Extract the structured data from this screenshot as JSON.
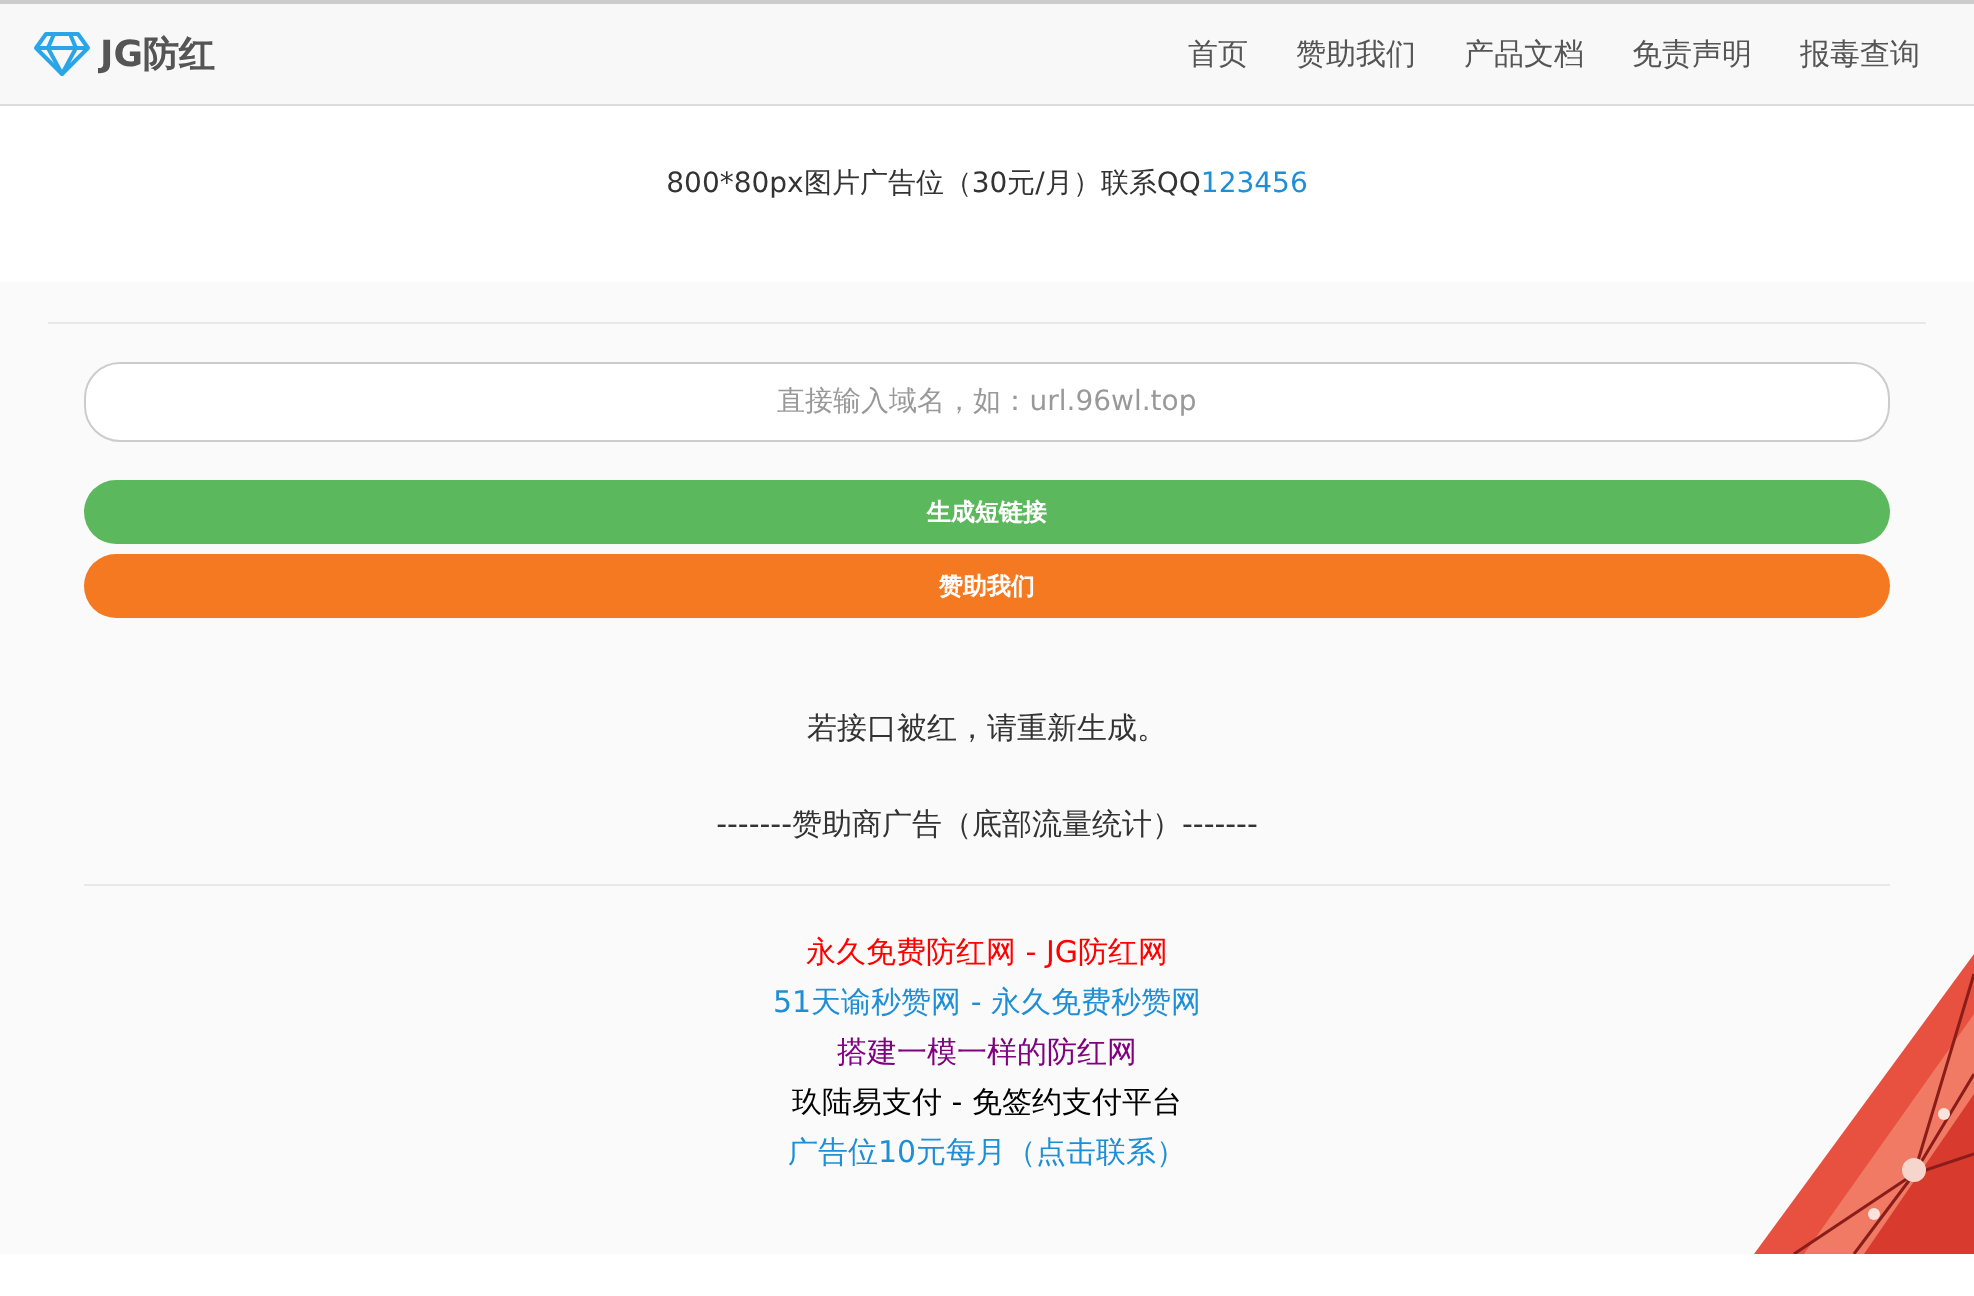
{
  "navbar": {
    "brand": "JG防红",
    "items": [
      "首页",
      "赞助我们",
      "产品文档",
      "免责声明",
      "报毒查询"
    ]
  },
  "ad_banner": {
    "text": "800*80px图片广告位（30元/月）联系QQ",
    "contact": "123456"
  },
  "form": {
    "placeholder": "直接输入域名，如：url.96wl.top",
    "buttons": [
      {
        "label": "生成短链接",
        "kind": "primary"
      },
      {
        "label": "赞助我们",
        "kind": "sponsor"
      }
    ]
  },
  "notice": "若接口被红，请重新生成。",
  "sponsor_heading": "-------赞助商广告（底部流量统计）-------",
  "sponsor_links": [
    {
      "text": "永久免费防红网 - JG防红网",
      "color": "#ff0000"
    },
    {
      "text": "51天谕秒赞网 - 永久免费秒赞网",
      "color": "#1e8fd6"
    },
    {
      "text": "搭建一模一样的防红网",
      "color": "#800080"
    },
    {
      "text": "玖陆易支付 - 免签约支付平台",
      "color": "#000000"
    },
    {
      "text": "广告位10元每月（点击联系）",
      "color": "#1e8fd6"
    }
  ]
}
